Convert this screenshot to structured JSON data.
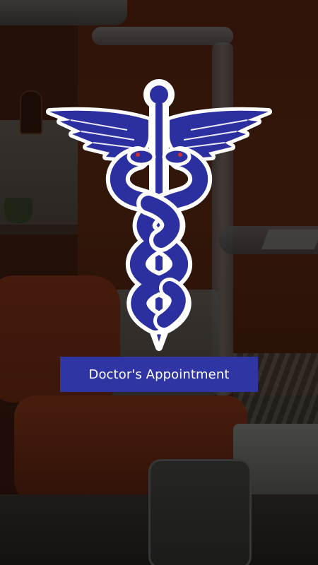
{
  "app": {
    "title": "Doctor's Appointment"
  },
  "logo": {
    "icon": "caduceus-icon"
  },
  "colors": {
    "accent": "#2f35a3",
    "logo_fill": "#2b2f9f",
    "logo_outline": "#ffffff",
    "snake_eye": "#d03030",
    "text": "#ffffff"
  }
}
